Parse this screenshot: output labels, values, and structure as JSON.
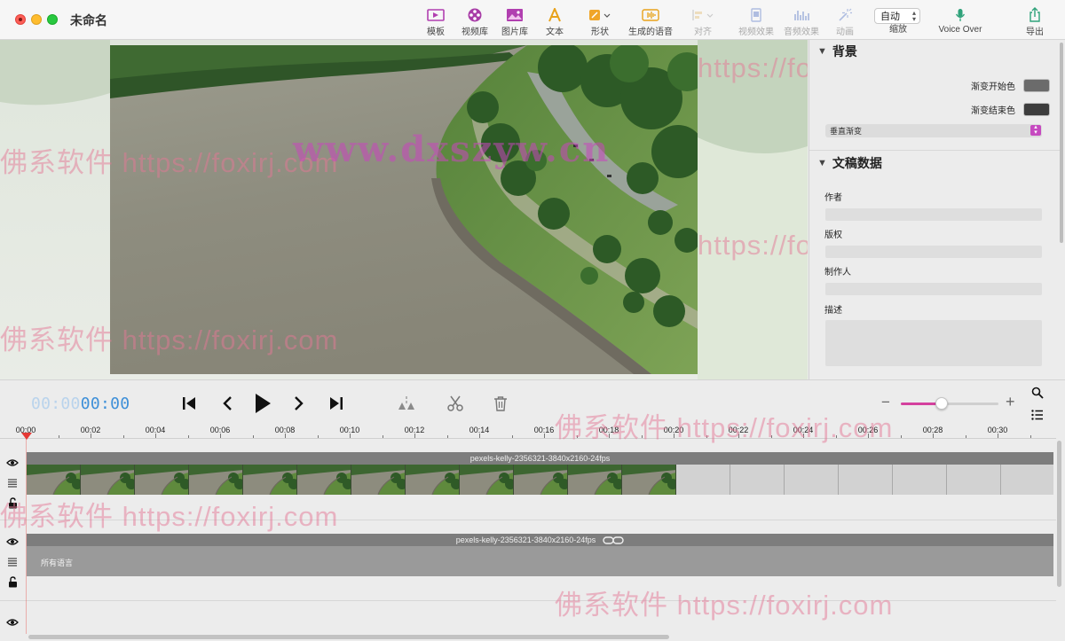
{
  "window": {
    "title": "未命名"
  },
  "toolbar": {
    "items": [
      {
        "label": "模板",
        "icon": "template-icon"
      },
      {
        "label": "视频库",
        "icon": "video-library-icon"
      },
      {
        "label": "图片库",
        "icon": "image-library-icon"
      },
      {
        "label": "文本",
        "icon": "text-icon"
      },
      {
        "label": "形状",
        "icon": "shape-icon"
      },
      {
        "label": "生成的语音",
        "icon": "generated-speech-icon"
      },
      {
        "label": "对齐",
        "icon": "align-icon",
        "disabled": true
      },
      {
        "label": "视频效果",
        "icon": "video-effects-icon",
        "disabled": true
      },
      {
        "label": "音频效果",
        "icon": "audio-effects-icon",
        "disabled": true
      },
      {
        "label": "动画",
        "icon": "animation-icon",
        "disabled": true
      },
      {
        "label": "缩放",
        "icon": "zoom-select"
      },
      {
        "label": "Voice Over",
        "icon": "microphone-icon"
      },
      {
        "label": "导出",
        "icon": "export-icon"
      }
    ],
    "zoom_value": "自动"
  },
  "preview": {
    "watermarks": [
      "佛系软件 https://foxirj.com",
      "https://foxirj.com",
      "www.dxszyw.cn"
    ]
  },
  "inspector": {
    "background": {
      "title": "背景",
      "start_color_label": "渐变开始色",
      "start_color": "#6b6b6b",
      "end_color_label": "渐变结束色",
      "end_color": "#3d3d3d",
      "gradient_mode": "垂直渐变"
    },
    "document": {
      "title": "文稿数据",
      "author_label": "作者",
      "copyright_label": "版权",
      "producer_label": "制作人",
      "description_label": "描述"
    }
  },
  "transport": {
    "timecode_dim": "00:00",
    "timecode_lit": "00:00",
    "zoom_level": 0.42
  },
  "ruler": {
    "labels": [
      "00:00",
      "00:02",
      "00:04",
      "00:06",
      "00:08",
      "00:10",
      "00:12",
      "00:14",
      "00:16",
      "00:18",
      "00:20",
      "00:22",
      "00:24",
      "00:26",
      "00:28",
      "00:30"
    ]
  },
  "tracks": {
    "video_clip_name": "pexels-kelly-2356321-3840x2160-24fps",
    "audio_clip_name": "pexels-kelly-2356321-3840x2160-24fps",
    "audio_language": "所有语言"
  },
  "colors": {
    "accent": "#d4419e",
    "timecode": "#3d8fd8",
    "playhead": "#e53935"
  }
}
